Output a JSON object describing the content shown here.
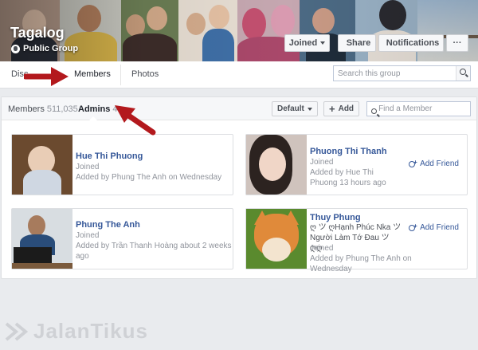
{
  "group": {
    "title": "Tagalog",
    "privacy": "Public Group",
    "privacy_icon": "globe-icon"
  },
  "cover_actions": {
    "joined": "Joined",
    "share": "Share",
    "notifications": "Notifications",
    "more": "···"
  },
  "nav": {
    "tabs": [
      {
        "label": "Discussion",
        "visible_label": "Disc"
      },
      {
        "label": "Members"
      },
      {
        "label": "Photos"
      }
    ],
    "search_placeholder": "Search this group"
  },
  "members_panel": {
    "members_label": "Members",
    "members_count": "511,035",
    "admins_label": "Admins",
    "admins_count": "4",
    "sort_label": "Default",
    "add_label": "Add",
    "find_placeholder": "Find a Member"
  },
  "admins": [
    {
      "name": "Hue Thi Phuong",
      "status": "Joined",
      "added": "Added by Phung The Anh on Wednesday",
      "add_friend": ""
    },
    {
      "name": "Phuong Thi Thanh",
      "status": "Joined",
      "added": "Added by Hue Thi Phuong 13 hours ago",
      "add_friend": "Add Friend"
    },
    {
      "name": "Phung The Anh",
      "status": "Joined",
      "added": "Added by Trần Thanh Hoàng about 2 weeks ago",
      "add_friend": ""
    },
    {
      "name": "Thuy Phung",
      "name_line2": "ღ ツ ღHạnh Phúc Nka ツ Người Làm Tớ Đau ツ ღღ",
      "status": "Joined",
      "added": "Added by Phung The Anh on Wednesday",
      "add_friend": "Add Friend"
    }
  ],
  "watermark": "JalanTikus",
  "colors": {
    "link_blue": "#365899",
    "annotation_red": "#b3191d",
    "background": "#e9ebee"
  }
}
